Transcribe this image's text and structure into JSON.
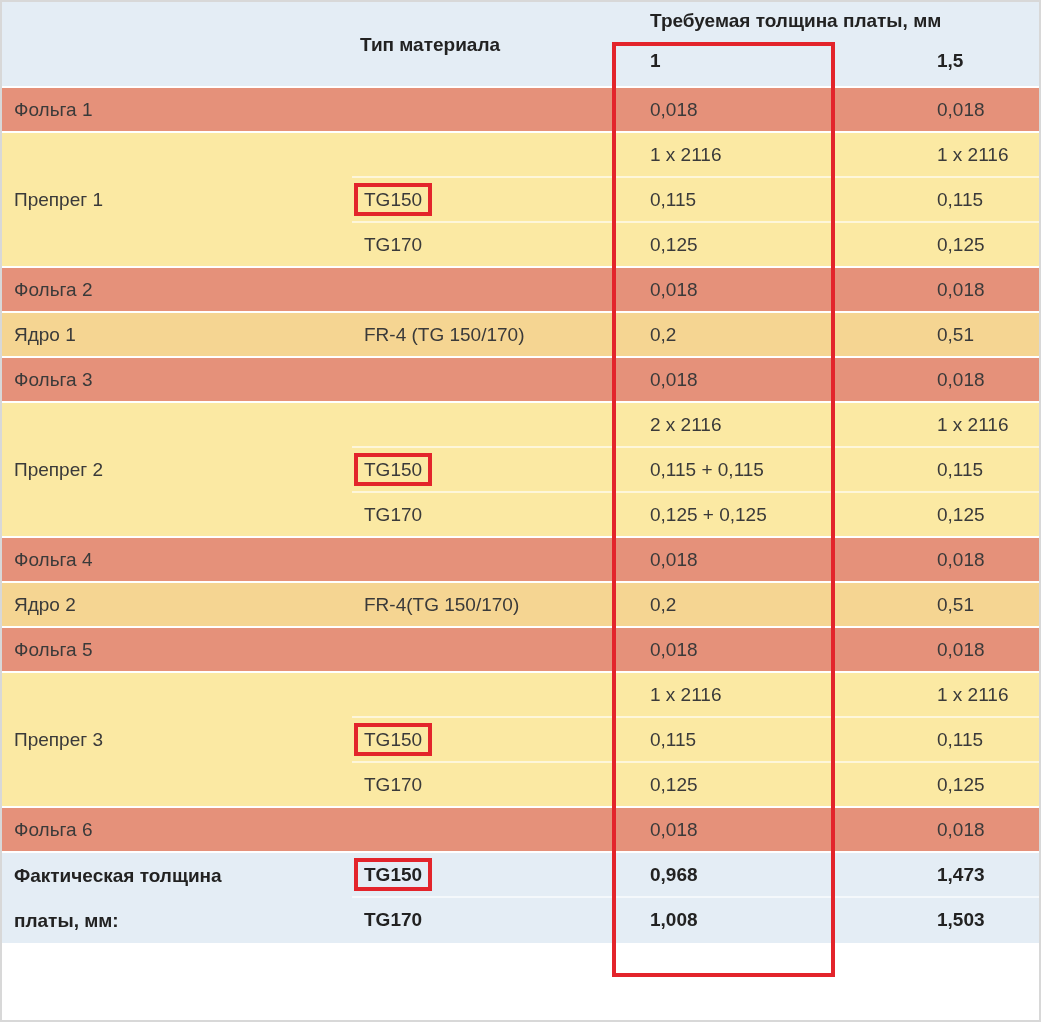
{
  "header": {
    "material_type": "Тип материала",
    "required_thickness": "Требуемая толщина платы, мм",
    "columns": [
      {
        "label": "1",
        "highlighted": true
      },
      {
        "label": "1,5",
        "highlighted": false
      }
    ]
  },
  "groups": [
    {
      "kind": "foil",
      "label": "Фольга 1",
      "rows": [
        {
          "values": [
            "0,018",
            "0,018"
          ]
        }
      ]
    },
    {
      "kind": "prepreg",
      "label": "Препрег 1",
      "rows": [
        {
          "values": [
            "1 x 2116",
            "1 x 2116"
          ]
        },
        {
          "type": "TG150",
          "highlighted": true,
          "values": [
            "0,115",
            "0,115"
          ]
        },
        {
          "type": "TG170",
          "highlighted": false,
          "values": [
            "0,125",
            "0,125"
          ]
        }
      ]
    },
    {
      "kind": "foil",
      "label": "Фольга 2",
      "rows": [
        {
          "values": [
            "0,018",
            "0,018"
          ]
        }
      ]
    },
    {
      "kind": "core",
      "label": "Ядро 1",
      "rows": [
        {
          "type": "FR-4 (TG 150/170)",
          "highlighted": false,
          "values": [
            "0,2",
            "0,51"
          ]
        }
      ]
    },
    {
      "kind": "foil",
      "label": "Фольга 3",
      "rows": [
        {
          "values": [
            "0,018",
            "0,018"
          ]
        }
      ]
    },
    {
      "kind": "prepreg",
      "label": "Препрег 2",
      "rows": [
        {
          "values": [
            "2 x 2116",
            "1 x 2116"
          ]
        },
        {
          "type": "TG150",
          "highlighted": true,
          "values": [
            "0,115 + 0,115",
            "0,115"
          ]
        },
        {
          "type": "TG170",
          "highlighted": false,
          "values": [
            "0,125 + 0,125",
            "0,125"
          ]
        }
      ]
    },
    {
      "kind": "foil",
      "label": "Фольга 4",
      "rows": [
        {
          "values": [
            "0,018",
            "0,018"
          ]
        }
      ]
    },
    {
      "kind": "core",
      "label": "Ядро 2",
      "rows": [
        {
          "type": "FR-4(TG 150/170)",
          "highlighted": false,
          "values": [
            "0,2",
            "0,51"
          ]
        }
      ]
    },
    {
      "kind": "foil",
      "label": "Фольга 5",
      "rows": [
        {
          "values": [
            "0,018",
            "0,018"
          ]
        }
      ]
    },
    {
      "kind": "prepreg",
      "label": "Препрег 3",
      "rows": [
        {
          "values": [
            "1 x 2116",
            "1 x 2116"
          ]
        },
        {
          "type": "TG150",
          "highlighted": true,
          "values": [
            "0,115",
            "0,115"
          ]
        },
        {
          "type": "TG170",
          "highlighted": false,
          "values": [
            "0,125",
            "0,125"
          ]
        }
      ]
    },
    {
      "kind": "foil",
      "label": "Фольга 6",
      "rows": [
        {
          "values": [
            "0,018",
            "0,018"
          ]
        }
      ]
    },
    {
      "kind": "total",
      "label": "Фактическая толщина платы, мм:",
      "rows": [
        {
          "type": "TG150",
          "highlighted": true,
          "values": [
            "0,968",
            "1,473"
          ]
        },
        {
          "type": "TG170",
          "highlighted": false,
          "values": [
            "1,008",
            "1,503"
          ]
        }
      ]
    }
  ]
}
